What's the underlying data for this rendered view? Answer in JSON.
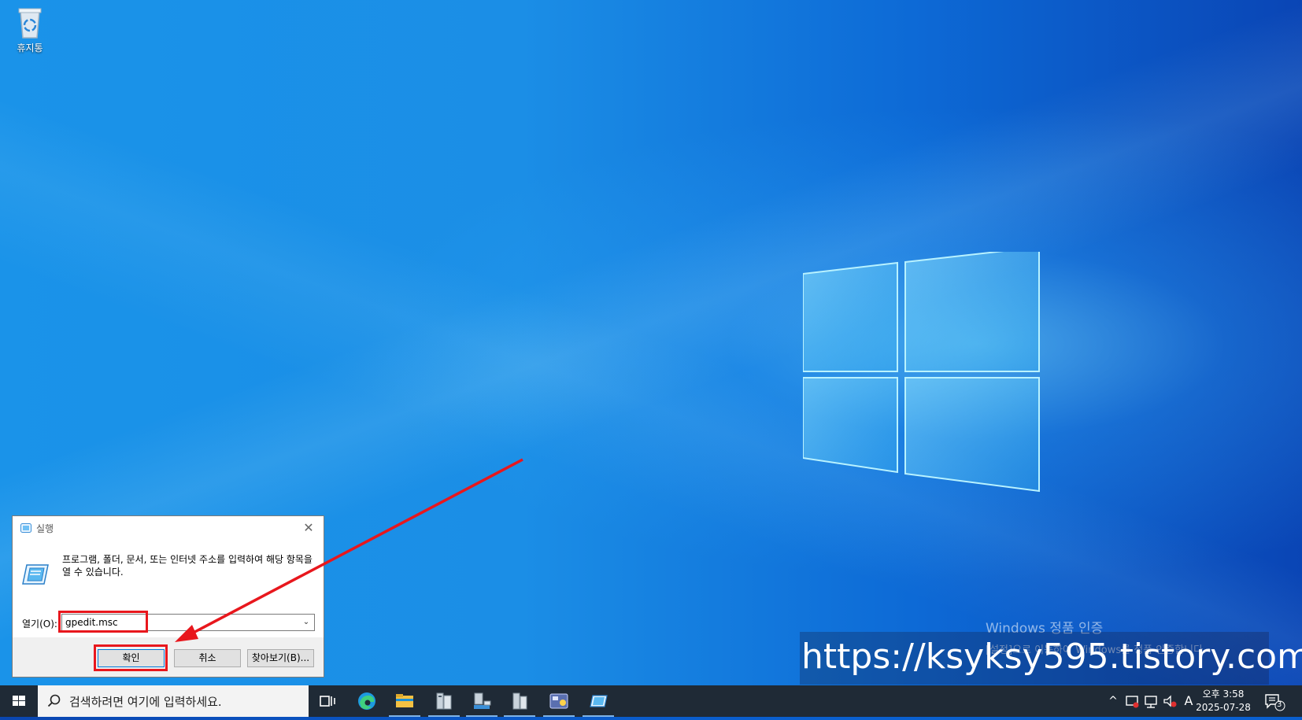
{
  "desktop": {
    "icons": [
      {
        "label": "휴지통",
        "icon": "recycle-bin-icon"
      }
    ]
  },
  "watermark": {
    "title": "Windows 정품 인증",
    "subtitle": "[설정]으로 이동하여 Windows를 정품 인증합니다."
  },
  "overlay": {
    "url_text": "https://ksyksy595.tistory.com"
  },
  "run_dialog": {
    "title": "실행",
    "description": "프로그램, 폴더, 문서, 또는 인터넷 주소를 입력하여 해당 항목을 열 수 있습니다.",
    "open_label": "열기(O):",
    "open_value": "gpedit.msc",
    "ok_label": "확인",
    "cancel_label": "취소",
    "browse_label": "찾아보기(B)...",
    "close_glyph": "✕",
    "annotation_color": "#e8171d"
  },
  "taskbar": {
    "search_placeholder": "검색하려면 여기에 입력하세요.",
    "pinned": [
      "task-view-icon",
      "edge-icon",
      "file-explorer-icon",
      "server-manager-icon",
      "network-icon",
      "server-icon",
      "admin-tools-icon",
      "run-icon"
    ],
    "tray": {
      "input_indicator": "A",
      "time": "오후 3:58",
      "date": "2025-07-28",
      "notification_count": "3"
    }
  }
}
